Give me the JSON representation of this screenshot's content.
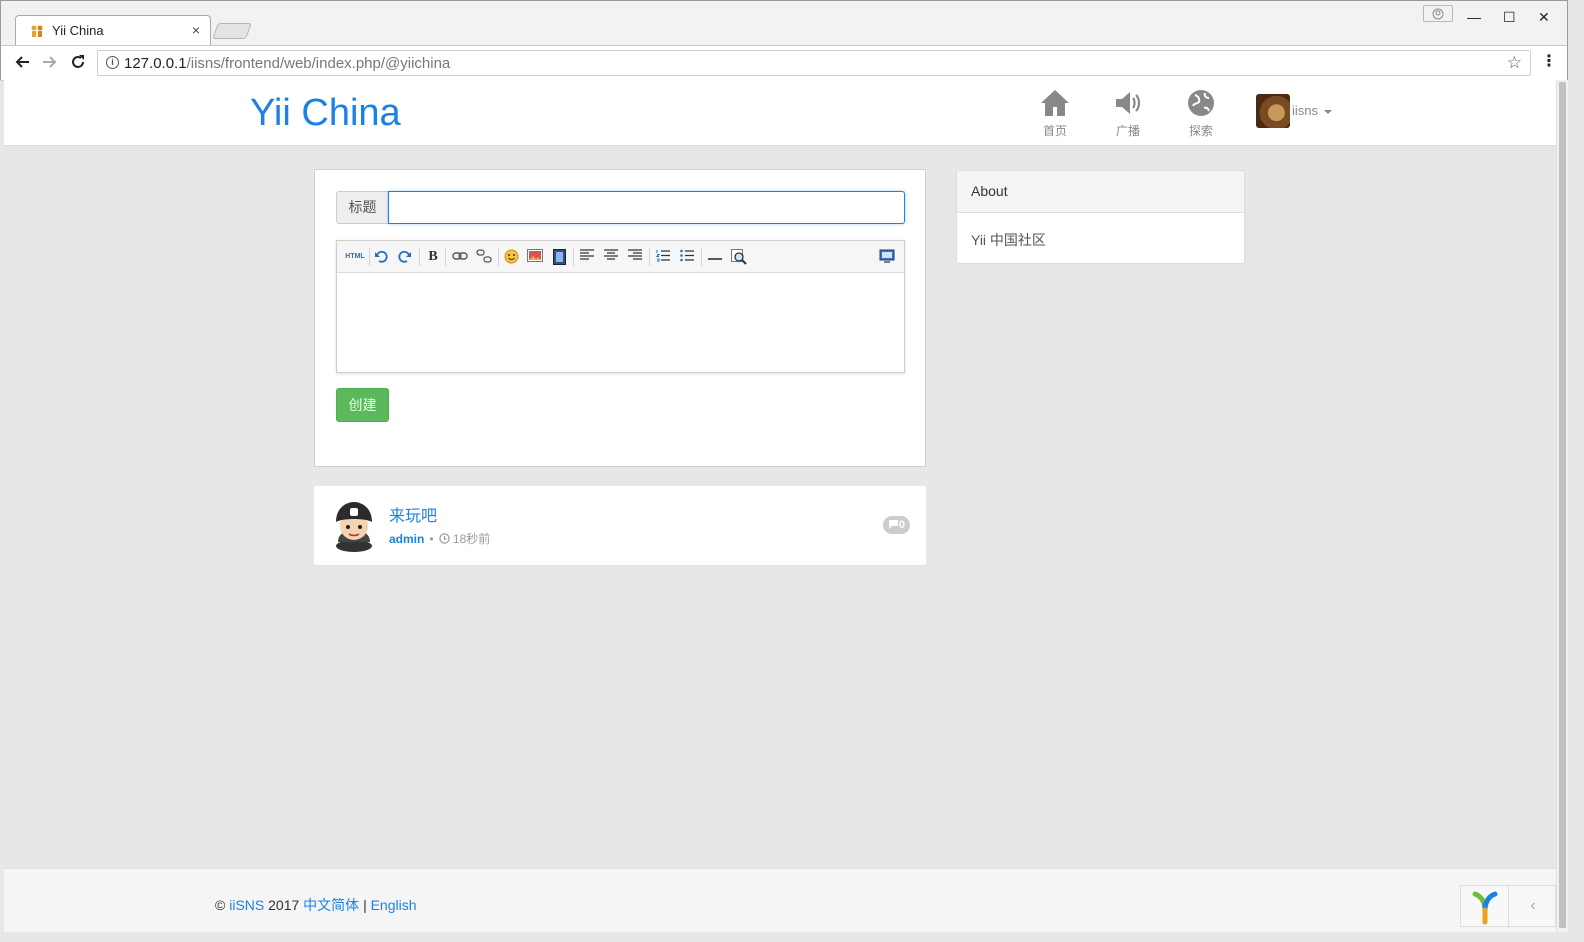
{
  "browser": {
    "tab_title": "Yii China",
    "tab_close": "×",
    "url_host": "127.0.0.1",
    "url_path": "/iisns/frontend/web/index.php/@yiichina",
    "window_buttons": {
      "minimize": "—",
      "maximize": "☐",
      "close": "✕"
    }
  },
  "navbar": {
    "brand": "Yii China",
    "items": [
      {
        "label": "首页",
        "icon": "home-icon"
      },
      {
        "label": "广播",
        "icon": "speaker-icon"
      },
      {
        "label": "探索",
        "icon": "globe-icon"
      }
    ],
    "user": {
      "name": "iisns"
    }
  },
  "post_form": {
    "title_label": "标题",
    "title_value": "",
    "toolbar_icons": [
      "html-icon",
      "undo-icon",
      "redo-icon",
      "bold-icon",
      "link-icon",
      "unlink-icon",
      "emoticon-icon",
      "image-icon",
      "video-icon",
      "align-left-icon",
      "align-center-icon",
      "align-right-icon",
      "ordered-list-icon",
      "unordered-list-icon",
      "horizontal-rule-icon",
      "preview-icon",
      "fullscreen-icon"
    ],
    "toolbar_html_label": "HTML",
    "toolbar_bold_label": "B",
    "create_button": "创建"
  },
  "posts": [
    {
      "title": "来玩吧",
      "author": "admin",
      "time": "18秒前",
      "comments": "0"
    }
  ],
  "sidebar": {
    "about_title": "About",
    "about_body": "Yii 中国社区"
  },
  "footer": {
    "copyright": "©",
    "site": "iiSNS",
    "year": "2017",
    "lang_zh": "中文简体",
    "separator": "|",
    "lang_en": "English"
  },
  "colors": {
    "brand": "#1a81e6",
    "success": "#5cb85c",
    "page_bg": "#e7e7e7"
  }
}
